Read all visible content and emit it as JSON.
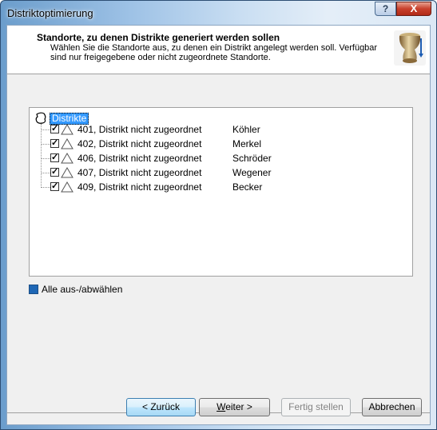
{
  "window": {
    "title": "Distriktoptimierung",
    "help_label": "?",
    "close_label": "X"
  },
  "header": {
    "title": "Standorte, zu denen Distrikte generiert werden sollen",
    "subtitle": "Wählen Sie die Standorte aus, zu denen ein Distrikt angelegt werden soll. Verfügbar sind nur freigegebene oder nicht zugeordnete Standorte.",
    "icon": "wizard-vase-icon"
  },
  "tree": {
    "root_label": "Distrikte",
    "root_icon": "district-outline-icon",
    "items": [
      {
        "text": "401, Distrikt  nicht zugeordnet",
        "name": "Köhler",
        "checked": true
      },
      {
        "text": "402, Distrikt  nicht zugeordnet",
        "name": "Merkel",
        "checked": true
      },
      {
        "text": "406, Distrikt  nicht zugeordnet",
        "name": "Schröder",
        "checked": true
      },
      {
        "text": "407, Distrikt  nicht zugeordnet",
        "name": "Wegener",
        "checked": true
      },
      {
        "text": "409, Distrikt  nicht zugeordnet",
        "name": "Becker",
        "checked": true
      }
    ],
    "item_icon": "triangle-icon"
  },
  "select_all": {
    "label": "Alle aus-/abwählen",
    "state": "indeterminate"
  },
  "buttons": {
    "back": "< Zurück",
    "next_prefix": "W",
    "next_rest": "eiter >",
    "finish": "Fertig stellen",
    "cancel": "Abbrechen"
  },
  "colors": {
    "selection": "#3399ff",
    "select_all_fill": "#1f67b5",
    "close_button": "#c8402c"
  }
}
